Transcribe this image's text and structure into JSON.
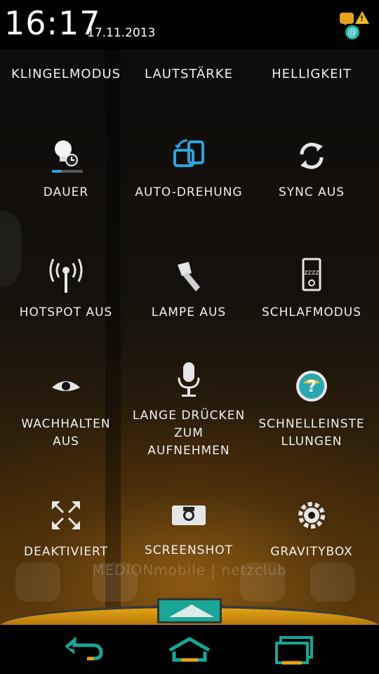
{
  "status_bar": {
    "time": "16:17",
    "date": "17.11.2013",
    "notification_icons": [
      "chat-icon",
      "warning-icon",
      "at-icon"
    ]
  },
  "top_buttons": [
    {
      "label": "KLINGELMODUS"
    },
    {
      "label": "LAUTSTÄRKE"
    },
    {
      "label": "HELLIGKEIT"
    }
  ],
  "tiles": [
    {
      "label": "DAUER",
      "icon": "screen-timeout-icon"
    },
    {
      "label": "AUTO-DREHUNG",
      "icon": "auto-rotate-icon"
    },
    {
      "label": "SYNC AUS",
      "icon": "sync-icon"
    },
    {
      "label": "HOTSPOT AUS",
      "icon": "hotspot-icon"
    },
    {
      "label": "LAMPE AUS",
      "icon": "flashlight-icon"
    },
    {
      "label": "SCHLAFMODUS",
      "icon": "sleep-icon"
    },
    {
      "label": "WACHHALTEN\nAUS",
      "icon": "eye-icon"
    },
    {
      "label": "LANGE DRÜCKEN\nZUM\nAUFNEHMEN",
      "icon": "microphone-icon"
    },
    {
      "label": "SCHNELLEINSTE\nLLUNGEN",
      "icon": "help-icon"
    },
    {
      "label": "DEAKTIVIERT",
      "icon": "expand-icon"
    },
    {
      "label": "SCREENSHOT",
      "icon": "camera-icon"
    },
    {
      "label": "GRAVITYBOX",
      "icon": "gear-icon"
    }
  ],
  "watermark": "MEDIONmobile | netzclub",
  "nav_bar": [
    "back-icon",
    "home-icon",
    "recents-icon"
  ],
  "colors": {
    "accent_blue": "#2fa3dc",
    "accent_teal": "#1aa596",
    "accent_amber": "#e4a414",
    "text": "#f0f0f0"
  }
}
